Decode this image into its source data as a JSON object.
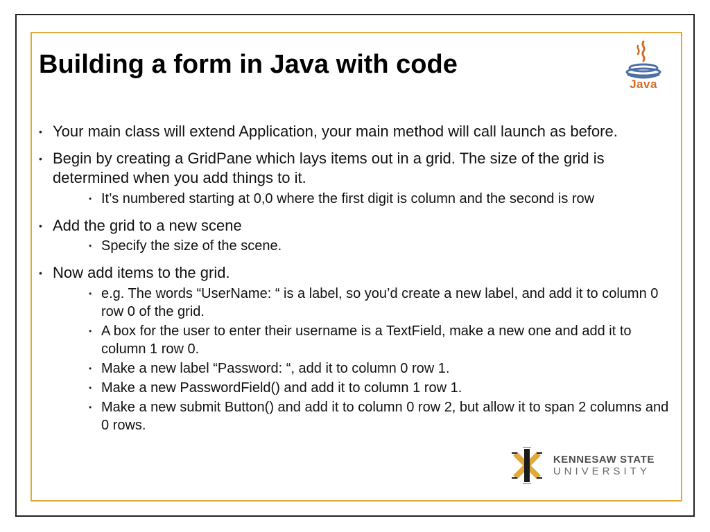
{
  "title": "Building a form in Java with code",
  "java_logo": {
    "label": "Java"
  },
  "bullets": [
    {
      "text": "Your main class will extend Application, your main method will call launch as before.",
      "subs": []
    },
    {
      "text": "Begin by creating a GridPane which lays items out in a grid.  The size of the grid is determined when you add things to it.",
      "subs": [
        "It’s numbered starting at 0,0 where the first digit is column and the second is row"
      ]
    },
    {
      "text": "Add the grid to a new scene",
      "subs": [
        "Specify the size of the scene."
      ]
    },
    {
      "text": "Now add items to the grid.",
      "subs": [
        "e.g.  The words “UserName: “ is a label, so you’d create a new label, and add it to column 0 row 0 of the grid.",
        "A box for the user to enter their username is a TextField, make a new one and add it to column 1 row 0.",
        "Make a new label “Password: “, add it to column 0 row 1.",
        "Make a new PasswordField() and add it to column 1 row 1.",
        "Make a new submit Button() and add it to column 0 row 2, but allow it to span 2 columns and 0 rows."
      ]
    }
  ],
  "ksu": {
    "top": "KENNESAW STATE",
    "bottom": "UNIVERSITY"
  }
}
